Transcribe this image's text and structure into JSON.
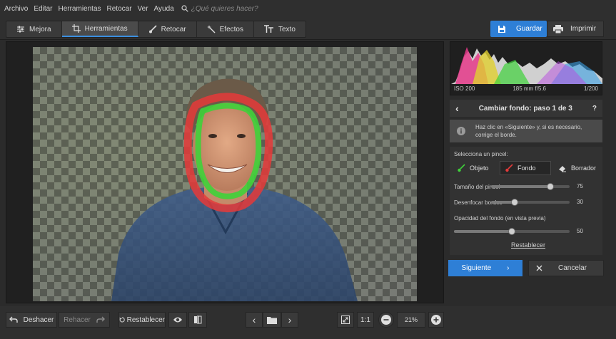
{
  "menu": {
    "items": [
      "Archivo",
      "Editar",
      "Herramientas",
      "Retocar",
      "Ver",
      "Ayuda"
    ],
    "search_placeholder": "¿Qué quieres hacer?"
  },
  "tabs": [
    {
      "label": "Mejora",
      "icon": "sliders-icon",
      "active": false
    },
    {
      "label": "Herramientas",
      "icon": "crop-icon",
      "active": true
    },
    {
      "label": "Retocar",
      "icon": "brush-icon",
      "active": false
    },
    {
      "label": "Efectos",
      "icon": "magic-wand-icon",
      "active": false
    },
    {
      "label": "Texto",
      "icon": "text-icon",
      "active": false
    }
  ],
  "actions": {
    "save": "Guardar",
    "print": "Imprimir"
  },
  "colors": {
    "accent": "#2e7fd6",
    "object_stroke": "#3fd13a",
    "background_stroke": "#e53a3a"
  },
  "histogram": {
    "iso": "ISO 200",
    "lens": "185 mm f/5.6",
    "shutter": "1/200"
  },
  "step": {
    "title": "Cambiar fondo: paso 1 de 3",
    "help": "?"
  },
  "info": {
    "text": "Haz clic en «Siguiente» y, si es necesario, corrige el borde."
  },
  "brush": {
    "label": "Selecciona un pincel:",
    "object": "Objeto",
    "background": "Fondo",
    "eraser": "Borrador",
    "selected": "Fondo"
  },
  "sliders": {
    "size": {
      "label": "Tamaño del pincel",
      "value": "75",
      "fraction": 0.75
    },
    "feather": {
      "label": "Desenfocar bordes",
      "value": "30",
      "fraction": 0.3
    },
    "opacity": {
      "label": "Opacidad del fondo (en vista previa)",
      "value": "50",
      "fraction": 0.5
    }
  },
  "reset_link": "Restablecer",
  "wizard": {
    "next": "Siguiente",
    "cancel": "Cancelar"
  },
  "bottom": {
    "undo": "Deshacer",
    "redo": "Rehacer",
    "reset": "Restablecer",
    "actual_size": "1:1",
    "zoom": "21%"
  }
}
